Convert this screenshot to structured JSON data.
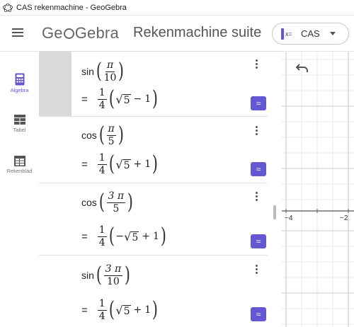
{
  "window": {
    "title": "CAS rekenmachine - GeoGebra"
  },
  "header": {
    "logo_text": "GeoGebra",
    "suite_title": "Rekenmachine suite",
    "app_switcher": {
      "icon_text": "x=",
      "label": "CAS"
    }
  },
  "rail": {
    "items": [
      {
        "label": "Algebra",
        "icon": "calculator-icon",
        "active": true
      },
      {
        "label": "Tabel",
        "icon": "table-icon",
        "active": false
      },
      {
        "label": "Rekenblad",
        "icon": "spreadsheet-icon",
        "active": false
      }
    ]
  },
  "algebra": {
    "rows": [
      {
        "fn": "sin",
        "arg_num": "π",
        "arg_den": "10",
        "coef_num": "1",
        "coef_den": "4",
        "sign": "",
        "radicand": "5",
        "op": "−",
        "term": "1",
        "approx": "≈"
      },
      {
        "fn": "cos",
        "arg_num": "π",
        "arg_den": "5",
        "coef_num": "1",
        "coef_den": "4",
        "sign": "",
        "radicand": "5",
        "op": "+",
        "term": "1",
        "approx": "≈"
      },
      {
        "fn": "cos",
        "arg_num": "3 π",
        "arg_den": "5",
        "coef_num": "1",
        "coef_den": "4",
        "sign": "−",
        "radicand": "5",
        "op": "+",
        "term": "1",
        "approx": "≈"
      },
      {
        "fn": "sin",
        "arg_num": "3 π",
        "arg_den": "10",
        "coef_num": "1",
        "coef_den": "4",
        "sign": "",
        "radicand": "5",
        "op": "+",
        "term": "1",
        "approx": "≈"
      }
    ],
    "equals": "="
  },
  "graphics": {
    "x_tick_labels": [
      "−4",
      "−2"
    ]
  },
  "colors": {
    "accent": "#6557d2",
    "selection": "#d9d9d9",
    "grid": "#e8e8e8"
  }
}
